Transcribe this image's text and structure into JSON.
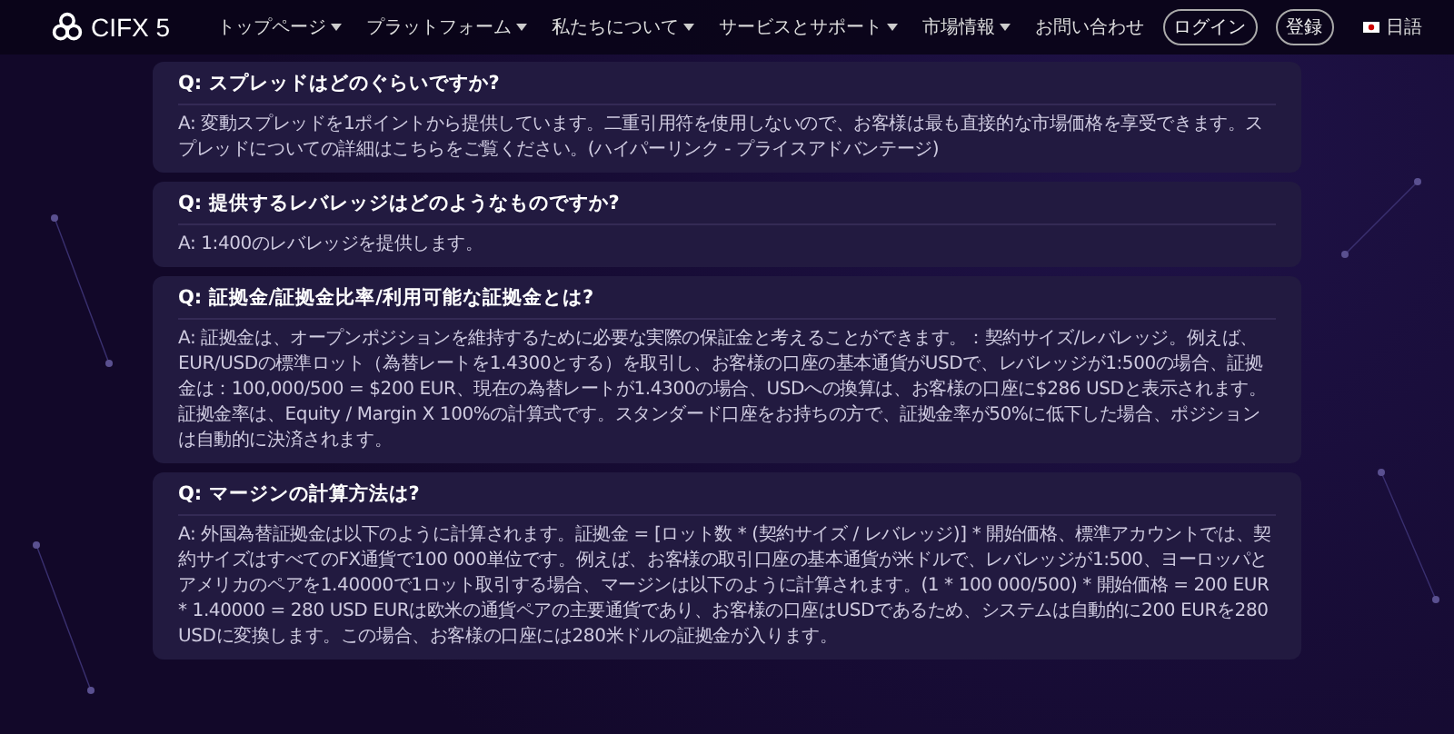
{
  "header": {
    "logo": "CIFX 5",
    "nav": [
      {
        "label": "トップページ",
        "dropdown": true
      },
      {
        "label": "プラットフォーム",
        "dropdown": true
      },
      {
        "label": "私たちについて",
        "dropdown": true
      },
      {
        "label": "サービスとサポート",
        "dropdown": true
      },
      {
        "label": "市場情報",
        "dropdown": true
      },
      {
        "label": "お問い合わせ",
        "dropdown": false
      }
    ],
    "login": "ログイン",
    "register": "登録",
    "language": "日語"
  },
  "faq": [
    {
      "question": "Q: スプレッドはどのぐらいですか?",
      "answer": "A: 変動スプレッドを1ポイントから提供しています。二重引用符を使用しないので、お客様は最も直接的な市場価格を享受できます。スプレッドについての詳細はこちらをご覧ください。(ハイパーリンク - プライスアドバンテージ)"
    },
    {
      "question": "Q: 提供するレバレッジはどのようなものですか?",
      "answer": "A: 1:400のレバレッジを提供します。"
    },
    {
      "question": "Q: 証拠金/証拠金比率/利用可能な証拠金とは?",
      "answer": "A: 証拠金は、オープンポジションを維持するために必要な実際の保証金と考えることができます。：契約サイズ/レバレッジ。例えば、EUR/USDの標準ロット（為替レートを1.4300とする）を取引し、お客様の口座の基本通貨がUSDで、レバレッジが1:500の場合、証拠金は：100,000/500 = $200 EUR、現在の為替レートが1.4300の場合、USDへの換算は、お客様の口座に$286 USDと表示されます。証拠金率は、Equity / Margin X 100%の計算式です。スタンダード口座をお持ちの方で、証拠金率が50%に低下した場合、ポジションは自動的に決済されます。"
    },
    {
      "question": "Q: マージンの計算方法は?",
      "answer": "A: 外国為替証拠金は以下のように計算されます。証拠金 = [ロット数 * (契約サイズ / レバレッジ)] * 開始価格、標準アカウントでは、契約サイズはすべてのFX通貨で100 000単位です。例えば、お客様の取引口座の基本通貨が米ドルで、レバレッジが1:500、ヨーロッパとアメリカのペアを1.40000で1ロット取引する場合、マージンは以下のように計算されます。(1 * 100 000/500) * 開始価格 = 200 EUR * 1.40000 = 280 USD EURは欧米の通貨ペアの主要通貨であり、お客様の口座はUSDであるため、システムは自動的に200 EURを280 USDに変換します。この場合、お客様の口座には280米ドルの証拠金が入ります。"
    }
  ]
}
